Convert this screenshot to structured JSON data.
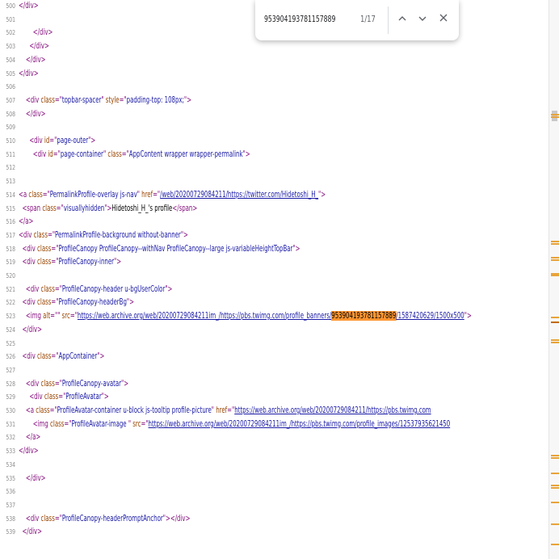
{
  "find_bar": {
    "query": "953904193781157889",
    "match_count": "1/17",
    "prev_icon": "chevron-up-icon",
    "next_icon": "chevron-down-icon",
    "close_icon": "close-icon"
  },
  "source_lines": [
    {
      "n": "500",
      "parts": [
        [
          "t",
          "</div>"
        ]
      ]
    },
    {
      "n": "501",
      "parts": []
    },
    {
      "n": "502",
      "parts": [
        [
          "tx",
          "        "
        ],
        [
          "t",
          "</div>"
        ]
      ]
    },
    {
      "n": "503",
      "parts": [
        [
          "tx",
          "      "
        ],
        [
          "t",
          "</div>"
        ]
      ]
    },
    {
      "n": "504",
      "parts": [
        [
          "tx",
          "    "
        ],
        [
          "t",
          "</div>"
        ]
      ]
    },
    {
      "n": "505",
      "parts": [
        [
          "t",
          "</div>"
        ]
      ]
    },
    {
      "n": "506",
      "parts": []
    },
    {
      "n": "507",
      "parts": [
        [
          "tx",
          "    "
        ],
        [
          "t",
          "<div "
        ],
        [
          "a",
          "class"
        ],
        [
          "t",
          "=\""
        ],
        [
          "v",
          "topbar-spacer"
        ],
        [
          "t",
          "\" "
        ],
        [
          "a",
          "style"
        ],
        [
          "t",
          "=\""
        ],
        [
          "v",
          "padding-top: 108px;"
        ],
        [
          "t",
          "\">"
        ]
      ]
    },
    {
      "n": "508",
      "parts": [
        [
          "tx",
          "    "
        ],
        [
          "t",
          "</div>"
        ]
      ]
    },
    {
      "n": "509",
      "parts": []
    },
    {
      "n": "510",
      "parts": [
        [
          "tx",
          "      "
        ],
        [
          "t",
          "<div "
        ],
        [
          "a",
          "id"
        ],
        [
          "t",
          "=\""
        ],
        [
          "v",
          "page-outer"
        ],
        [
          "t",
          "\">"
        ]
      ]
    },
    {
      "n": "511",
      "parts": [
        [
          "tx",
          "        "
        ],
        [
          "t",
          "<div "
        ],
        [
          "a",
          "id"
        ],
        [
          "t",
          "=\""
        ],
        [
          "v",
          "page-container"
        ],
        [
          "t",
          "\" "
        ],
        [
          "a",
          "class"
        ],
        [
          "t",
          "=\""
        ],
        [
          "v",
          "AppContent wrapper wrapper-permalink"
        ],
        [
          "t",
          "\">"
        ]
      ]
    },
    {
      "n": "512",
      "parts": []
    },
    {
      "n": "513",
      "parts": []
    },
    {
      "n": "514",
      "parts": [
        [
          "t",
          "<a "
        ],
        [
          "a",
          "class"
        ],
        [
          "t",
          "=\""
        ],
        [
          "v",
          "PermalinkProfile-overlay js-nav"
        ],
        [
          "t",
          "\" "
        ],
        [
          "a",
          "href"
        ],
        [
          "t",
          "=\""
        ],
        [
          "u",
          "/web/20200729084211/https://twitter.com/Hidetoshi_H_"
        ],
        [
          "t",
          "\">"
        ]
      ]
    },
    {
      "n": "515",
      "parts": [
        [
          "tx",
          "  "
        ],
        [
          "t",
          "<span "
        ],
        [
          "a",
          "class"
        ],
        [
          "t",
          "=\""
        ],
        [
          "v",
          "visuallyhidden"
        ],
        [
          "t",
          "\">"
        ],
        [
          "tx",
          "Hidetoshi_H_'s profile"
        ],
        [
          "t",
          "</span>"
        ]
      ]
    },
    {
      "n": "516",
      "parts": [
        [
          "t",
          "</a>"
        ]
      ]
    },
    {
      "n": "517",
      "parts": [
        [
          "t",
          "<div "
        ],
        [
          "a",
          "class"
        ],
        [
          "t",
          "=\""
        ],
        [
          "v",
          "PermalinkProfile-background without-banner"
        ],
        [
          "t",
          "\">"
        ]
      ]
    },
    {
      "n": "518",
      "parts": [
        [
          "tx",
          "  "
        ],
        [
          "t",
          "<div "
        ],
        [
          "a",
          "class"
        ],
        [
          "t",
          "=\""
        ],
        [
          "v",
          "ProfileCanopy ProfileCanopy--withNav ProfileCanopy--large js-variableHeightTopBar"
        ],
        [
          "t",
          "\">"
        ]
      ]
    },
    {
      "n": "519",
      "parts": [
        [
          "tx",
          "  "
        ],
        [
          "t",
          "<div "
        ],
        [
          "a",
          "class"
        ],
        [
          "t",
          "=\""
        ],
        [
          "v",
          "ProfileCanopy-inner"
        ],
        [
          "t",
          "\">"
        ]
      ]
    },
    {
      "n": "520",
      "parts": []
    },
    {
      "n": "521",
      "parts": [
        [
          "tx",
          "    "
        ],
        [
          "t",
          "<div "
        ],
        [
          "a",
          "class"
        ],
        [
          "t",
          "=\""
        ],
        [
          "v",
          "ProfileCanopy-header u-bgUserColor"
        ],
        [
          "t",
          "\">"
        ]
      ]
    },
    {
      "n": "522",
      "parts": [
        [
          "tx",
          "  "
        ],
        [
          "t",
          "<div "
        ],
        [
          "a",
          "class"
        ],
        [
          "t",
          "=\""
        ],
        [
          "v",
          "ProfileCanopy-headerBg"
        ],
        [
          "t",
          "\">"
        ]
      ]
    },
    {
      "n": "523",
      "parts": [
        [
          "tx",
          "    "
        ],
        [
          "t",
          "<img "
        ],
        [
          "a",
          "alt"
        ],
        [
          "t",
          "=\"\" "
        ],
        [
          "a",
          "src"
        ],
        [
          "t",
          "=\""
        ],
        [
          "u",
          "https://web.archive.org/web/20200729084211im_/https://pbs.twimg.com/profile_banners/"
        ],
        [
          "hl",
          "953904193781157889"
        ],
        [
          "u",
          "/1587420629/1500x500"
        ],
        [
          "t",
          "\">"
        ]
      ]
    },
    {
      "n": "524",
      "parts": [
        [
          "tx",
          "  "
        ],
        [
          "t",
          "</div>"
        ]
      ]
    },
    {
      "n": "525",
      "parts": []
    },
    {
      "n": "526",
      "parts": [
        [
          "tx",
          "  "
        ],
        [
          "t",
          "<div "
        ],
        [
          "a",
          "class"
        ],
        [
          "t",
          "=\""
        ],
        [
          "v",
          "AppContainer"
        ],
        [
          "t",
          "\">"
        ]
      ]
    },
    {
      "n": "527",
      "parts": []
    },
    {
      "n": "528",
      "parts": [
        [
          "tx",
          "    "
        ],
        [
          "t",
          "<div "
        ],
        [
          "a",
          "class"
        ],
        [
          "t",
          "=\""
        ],
        [
          "v",
          "ProfileCanopy-avatar"
        ],
        [
          "t",
          "\">"
        ]
      ]
    },
    {
      "n": "529",
      "parts": [
        [
          "tx",
          "      "
        ],
        [
          "t",
          "<div "
        ],
        [
          "a",
          "class"
        ],
        [
          "t",
          "=\""
        ],
        [
          "v",
          "ProfileAvatar"
        ],
        [
          "t",
          "\">"
        ]
      ]
    },
    {
      "n": "530",
      "parts": [
        [
          "tx",
          "    "
        ],
        [
          "t",
          "<a "
        ],
        [
          "a",
          "class"
        ],
        [
          "t",
          "=\""
        ],
        [
          "v",
          "ProfileAvatar-container u-block js-tooltip profile-picture"
        ],
        [
          "t",
          "\" "
        ],
        [
          "a",
          "href"
        ],
        [
          "t",
          "=\""
        ],
        [
          "u",
          "https://web.archive.org/web/20200729084211/https://pbs.twimg.com"
        ]
      ]
    },
    {
      "n": "531",
      "parts": [
        [
          "tx",
          "        "
        ],
        [
          "t",
          "<img "
        ],
        [
          "a",
          "class"
        ],
        [
          "t",
          "=\""
        ],
        [
          "v",
          "ProfileAvatar-image "
        ],
        [
          "t",
          "\" "
        ],
        [
          "a",
          "src"
        ],
        [
          "t",
          "=\""
        ],
        [
          "u",
          "https://web.archive.org/web/20200729084211im_/https://pbs.twimg.com/profile_images/12537935621450"
        ]
      ]
    },
    {
      "n": "532",
      "parts": [
        [
          "tx",
          "    "
        ],
        [
          "t",
          "</a>"
        ]
      ]
    },
    {
      "n": "533",
      "parts": [
        [
          "t",
          "</div>"
        ]
      ]
    },
    {
      "n": "534",
      "parts": []
    },
    {
      "n": "535",
      "parts": [
        [
          "tx",
          "    "
        ],
        [
          "t",
          "</div>"
        ]
      ]
    },
    {
      "n": "536",
      "parts": []
    },
    {
      "n": "537",
      "parts": []
    },
    {
      "n": "538",
      "parts": [
        [
          "tx",
          "    "
        ],
        [
          "t",
          "<div "
        ],
        [
          "a",
          "class"
        ],
        [
          "t",
          "=\""
        ],
        [
          "v",
          "ProfileCanopy-headerPromptAnchor"
        ],
        [
          "t",
          "\"></div>"
        ]
      ]
    },
    {
      "n": "539",
      "parts": [
        [
          "tx",
          "  "
        ],
        [
          "t",
          "</div>"
        ]
      ]
    }
  ],
  "scroll_markers": [
    0.204,
    0.208,
    0.431,
    0.435,
    0.46,
    0.464,
    0.488,
    0.492,
    0.566,
    0.575,
    0.607,
    0.611,
    0.814,
    0.818,
    0.845,
    0.867,
    0.871,
    0.898,
    0.937,
    0.973
  ],
  "current_marker": 0.575,
  "scroll_position": 0.198,
  "colors": {
    "tag": "#881280",
    "attribute": "#994500",
    "value": "#1a1aa6",
    "match_highlight": "#ff9632",
    "marker": "#e8a33b"
  }
}
